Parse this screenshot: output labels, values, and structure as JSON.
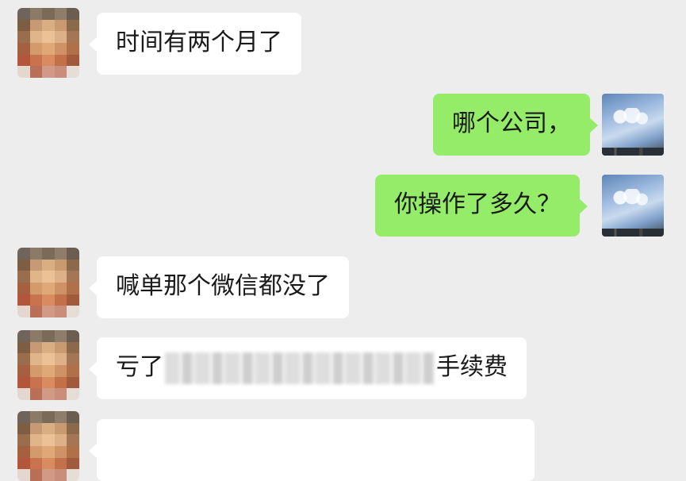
{
  "messages": [
    {
      "side": "left",
      "text": "时间有两个月了"
    },
    {
      "side": "right",
      "text": "哪个公司，"
    },
    {
      "side": "right",
      "text": "你操作了多久？"
    },
    {
      "side": "left",
      "text": "喊单那个微信都没了"
    },
    {
      "side": "left",
      "text_before": "亏了",
      "text_after": "手续费",
      "redacted": true
    },
    {
      "side": "left",
      "text": ""
    }
  ],
  "colors": {
    "background": "#ededed",
    "incoming_bubble": "#ffffff",
    "outgoing_bubble": "#95ec69"
  }
}
